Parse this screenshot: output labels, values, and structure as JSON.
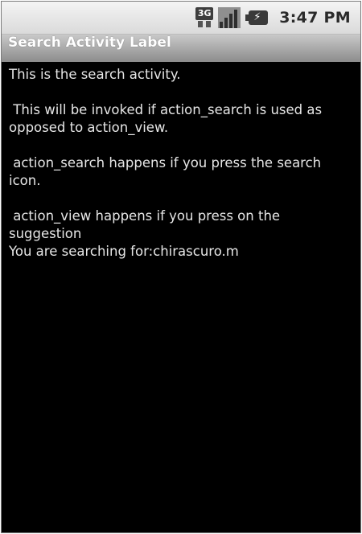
{
  "status_bar": {
    "network_type": "3G",
    "time": "3:47 PM",
    "icons": [
      "3g-data-icon",
      "signal-strength-icon",
      "battery-charging-icon"
    ]
  },
  "title_bar": {
    "title": "Search Activity Label"
  },
  "content": {
    "lines": [
      "This is the search activity.",
      " This will be invoked if action_search is used as opposed to action_view.",
      " action_search happens if you press the search icon.",
      " action_view happens if you press on the suggestion",
      "You are searching for:chirascuro.m"
    ]
  }
}
